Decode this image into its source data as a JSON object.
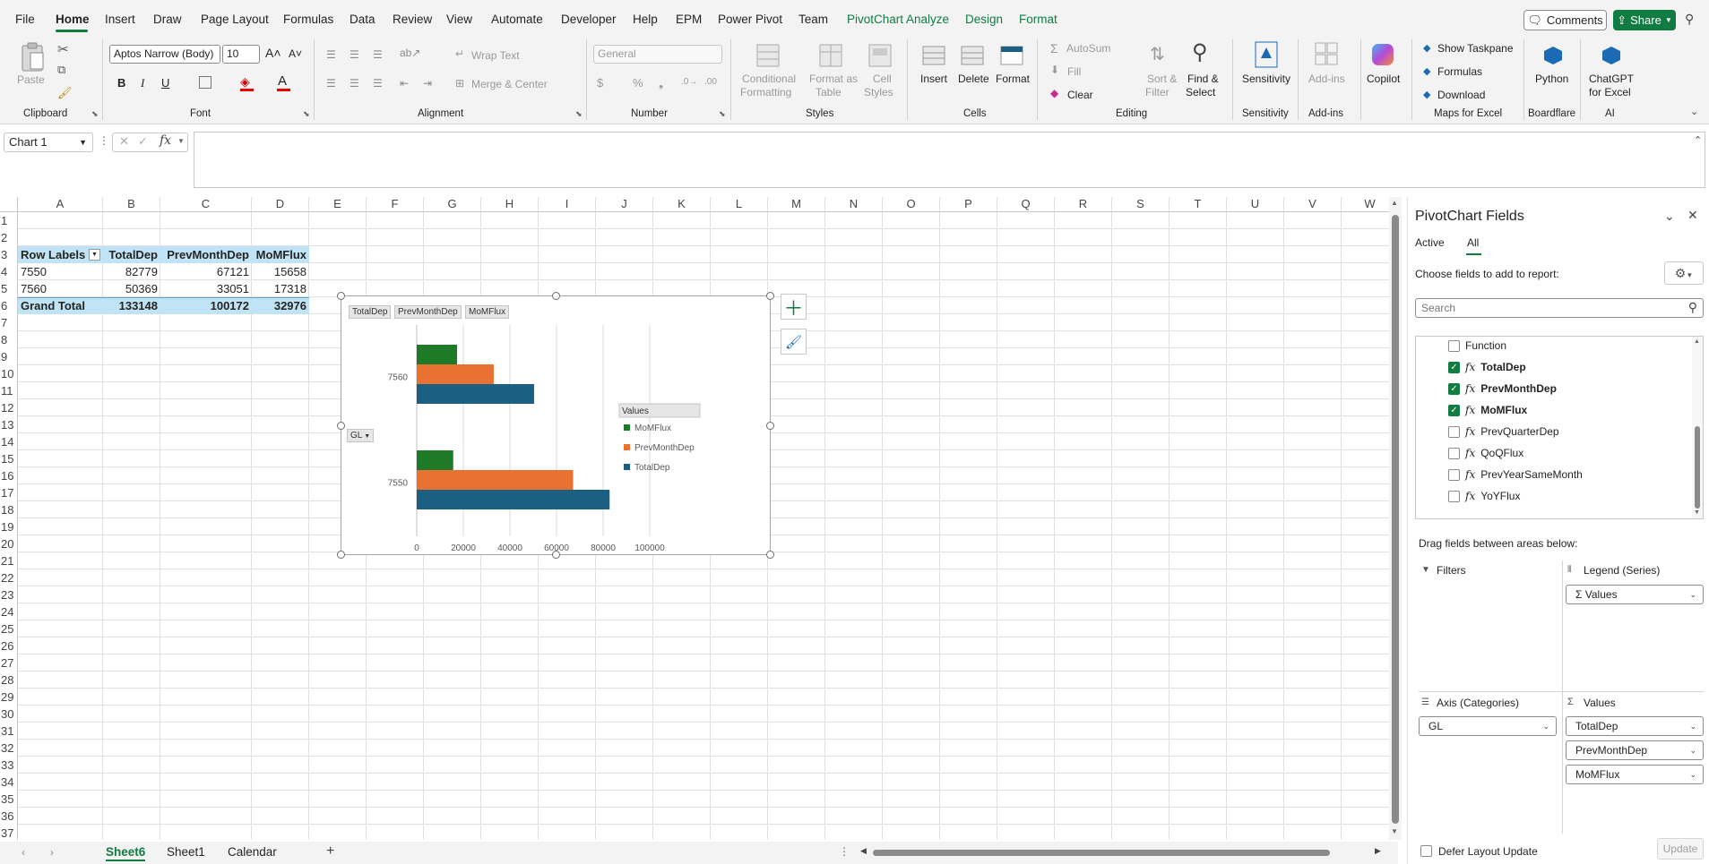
{
  "menu": {
    "tabs": [
      "File",
      "Home",
      "Insert",
      "Draw",
      "Page Layout",
      "Formulas",
      "Data",
      "Review",
      "View",
      "Automate",
      "Developer",
      "Help",
      "EPM",
      "Power Pivot",
      "Team",
      "PivotChart Analyze",
      "Design",
      "Format"
    ],
    "comments_label": "Comments",
    "share_label": "Share"
  },
  "ribbon": {
    "clipboard": {
      "paste": "Paste",
      "group": "Clipboard"
    },
    "font": {
      "name": "Aptos Narrow (Body)",
      "size": "10",
      "group": "Font",
      "bold": "B",
      "italic": "I",
      "underline": "U"
    },
    "alignment": {
      "wrap": "Wrap Text",
      "merge": "Merge & Center",
      "group": "Alignment"
    },
    "number": {
      "format": "General",
      "group": "Number"
    },
    "styles": {
      "conditional": "Conditional",
      "conditional2": "Formatting",
      "format_table": "Format as",
      "format_table2": "Table",
      "cell_styles": "Cell",
      "cell_styles2": "Styles",
      "group": "Styles"
    },
    "cells": {
      "insert": "Insert",
      "delete": "Delete",
      "format": "Format",
      "group": "Cells"
    },
    "editing": {
      "autosum": "AutoSum",
      "fill": "Fill",
      "clear": "Clear",
      "sort": "Sort &",
      "sort2": "Filter",
      "find": "Find &",
      "find2": "Select",
      "group": "Editing"
    },
    "sensitivity": {
      "label": "Sensitivity",
      "group": "Sensitivity"
    },
    "addins": {
      "label": "Add-ins",
      "group": "Add-ins"
    },
    "copilot": {
      "label": "Copilot"
    },
    "maps": {
      "taskpane": "Show Taskpane",
      "formulas": "Formulas",
      "download": "Download",
      "group": "Maps for Excel"
    },
    "boardflare": {
      "label": "Python",
      "group": "Boardflare"
    },
    "ai": {
      "label": "ChatGPT",
      "label2": "for Excel",
      "group": "AI"
    }
  },
  "formula_bar": {
    "name_box": "Chart 1",
    "fx": "fx",
    "value": ""
  },
  "grid": {
    "columns": [
      "A",
      "B",
      "C",
      "D",
      "E",
      "F",
      "G",
      "H",
      "I",
      "J",
      "K",
      "L",
      "M",
      "N",
      "O",
      "P",
      "Q",
      "R",
      "S",
      "T",
      "U",
      "V",
      "W"
    ],
    "rows": [
      "1",
      "2",
      "3",
      "4",
      "5",
      "6",
      "7",
      "8",
      "9",
      "10",
      "11",
      "12",
      "13",
      "14",
      "15",
      "16",
      "17",
      "18",
      "19",
      "20",
      "21",
      "22",
      "23",
      "24",
      "25",
      "26",
      "27",
      "28",
      "29",
      "30",
      "31",
      "32",
      "33",
      "34",
      "35",
      "36",
      "37"
    ],
    "pivot": {
      "headers": [
        "Row Labels",
        "TotalDep",
        "PrevMonthDep",
        "MoMFlux"
      ],
      "rows": [
        [
          "7550",
          "82779",
          "67121",
          "15658"
        ],
        [
          "7560",
          "50369",
          "33051",
          "17318"
        ]
      ],
      "total": [
        "Grand Total",
        "133148",
        "100172",
        "32976"
      ]
    }
  },
  "chart_data": {
    "type": "bar",
    "orientation": "horizontal",
    "categories": [
      "7550",
      "7560"
    ],
    "series": [
      {
        "name": "TotalDep",
        "values": [
          82779,
          50369
        ],
        "color": "#1b5f82"
      },
      {
        "name": "PrevMonthDep",
        "values": [
          67121,
          33051
        ],
        "color": "#e97132"
      },
      {
        "name": "MoMFlux",
        "values": [
          15658,
          17318
        ],
        "color": "#1f7a28"
      }
    ],
    "xlim": [
      0,
      100000
    ],
    "xticks": [
      "0",
      "20000",
      "40000",
      "60000",
      "80000",
      "100000"
    ],
    "field_buttons": [
      "TotalDep",
      "PrevMonthDep",
      "MoMFlux"
    ],
    "axis_field_button": "GL",
    "legend_title": "Values",
    "legend_entries": [
      "MoMFlux",
      "PrevMonthDep",
      "TotalDep"
    ],
    "legend_position": "right",
    "grid": true
  },
  "panel": {
    "title": "PivotChart Fields",
    "tabs": [
      "Active",
      "All"
    ],
    "choose_label": "Choose fields to add to report:",
    "search_placeholder": "Search",
    "fields": [
      {
        "label": "Function",
        "checked": false,
        "fx": false
      },
      {
        "label": "TotalDep",
        "checked": true,
        "fx": true
      },
      {
        "label": "PrevMonthDep",
        "checked": true,
        "fx": true
      },
      {
        "label": "MoMFlux",
        "checked": true,
        "fx": true
      },
      {
        "label": "PrevQuarterDep",
        "checked": false,
        "fx": true
      },
      {
        "label": "QoQFlux",
        "checked": false,
        "fx": true
      },
      {
        "label": "PrevYearSameMonth",
        "checked": false,
        "fx": true
      },
      {
        "label": "YoYFlux",
        "checked": false,
        "fx": true
      }
    ],
    "drag_label": "Drag fields between areas below:",
    "filters_label": "Filters",
    "legend_label": "Legend (Series)",
    "legend_field": "Values",
    "axis_label": "Axis (Categories)",
    "axis_field": "GL",
    "values_label": "Values",
    "values_fields": [
      "TotalDep",
      "PrevMonthDep",
      "MoMFlux"
    ],
    "defer_label": "Defer Layout Update",
    "update_label": "Update"
  },
  "sheets": {
    "tabs": [
      "Sheet6",
      "Sheet1",
      "Calendar"
    ],
    "active": "Sheet6"
  }
}
